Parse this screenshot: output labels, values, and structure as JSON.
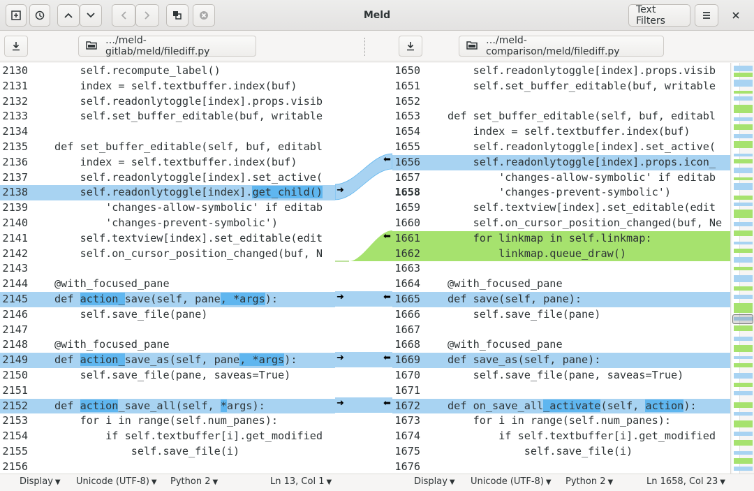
{
  "window": {
    "title": "Meld",
    "text_filters_label": "Text Filters"
  },
  "toolbar": {
    "icons": [
      "new-comparison-icon",
      "recent-icon",
      "prev-change-icon",
      "next-change-icon",
      "back-icon",
      "forward-icon",
      "copy-icon",
      "stop-icon",
      "menu-icon",
      "close-icon"
    ]
  },
  "files": {
    "left_path": "…/meld-gitlab/meld/filediff.py",
    "right_path": "…/meld-comparison/meld/filediff.py"
  },
  "left_lines": [
    {
      "n": "2130",
      "t": "    self.recompute_label()",
      "s": ""
    },
    {
      "n": "2131",
      "t": "    index = self.textbuffer.index(buf)",
      "s": ""
    },
    {
      "n": "2132",
      "t": "    self.readonlytoggle[index].props.visib",
      "s": ""
    },
    {
      "n": "2133",
      "t": "    self.set_buffer_editable(buf, writable",
      "s": ""
    },
    {
      "n": "2134",
      "t": "",
      "s": ""
    },
    {
      "n": "2135",
      "t": "def set_buffer_editable(self, buf, editabl",
      "s": ""
    },
    {
      "n": "2136",
      "t": "    index = self.textbuffer.index(buf)",
      "s": ""
    },
    {
      "n": "2137",
      "t": "    self.readonlytoggle[index].set_active(",
      "s": ""
    },
    {
      "n": "2138",
      "t": "    self.readonlytoggle[index].",
      "h": "get_child()",
      "s": "chg"
    },
    {
      "n": "2139",
      "t": "        'changes-allow-symbolic' if editab",
      "s": ""
    },
    {
      "n": "2140",
      "t": "        'changes-prevent-symbolic')",
      "s": ""
    },
    {
      "n": "2141",
      "t": "    self.textview[index].set_editable(edit",
      "s": ""
    },
    {
      "n": "2142",
      "t": "    self.on_cursor_position_changed(buf, N",
      "s": ""
    },
    {
      "n": "2143",
      "t": "",
      "s": ""
    },
    {
      "n": "2144",
      "t": "@with_focused_pane",
      "s": ""
    },
    {
      "n": "2145",
      "segs": [
        [
          "def ",
          ""
        ],
        [
          "action_",
          "hl"
        ],
        [
          "save(self, pane",
          ""
        ],
        [
          ", *args",
          "hl"
        ],
        [
          "):",
          ""
        ]
      ],
      "s": "chg"
    },
    {
      "n": "2146",
      "t": "    self.save_file(pane)",
      "s": ""
    },
    {
      "n": "2147",
      "t": "",
      "s": ""
    },
    {
      "n": "2148",
      "t": "@with_focused_pane",
      "s": ""
    },
    {
      "n": "2149",
      "segs": [
        [
          "def ",
          ""
        ],
        [
          "action_",
          "hl"
        ],
        [
          "save_as(self, pane",
          ""
        ],
        [
          ", *args",
          "hl"
        ],
        [
          "):",
          ""
        ]
      ],
      "s": "chg"
    },
    {
      "n": "2150",
      "t": "    self.save_file(pane, saveas=True)",
      "s": ""
    },
    {
      "n": "2151",
      "t": "",
      "s": ""
    },
    {
      "n": "2152",
      "segs": [
        [
          "def ",
          ""
        ],
        [
          "action",
          "hl"
        ],
        [
          "_save_all(self, ",
          ""
        ],
        [
          "*",
          "hl"
        ],
        [
          "args):",
          ""
        ]
      ],
      "s": "chg"
    },
    {
      "n": "2153",
      "t": "    for i in range(self.num_panes):",
      "s": ""
    },
    {
      "n": "2154",
      "t": "        if self.textbuffer[i].get_modified",
      "s": ""
    },
    {
      "n": "2155",
      "t": "            self.save_file(i)",
      "s": ""
    },
    {
      "n": "2156",
      "t": "",
      "s": ""
    }
  ],
  "right_lines": [
    {
      "n": "1650",
      "t": "    self.readonlytoggle[index].props.visib",
      "s": ""
    },
    {
      "n": "1651",
      "t": "    self.set_buffer_editable(buf, writable",
      "s": ""
    },
    {
      "n": "1652",
      "t": "",
      "s": ""
    },
    {
      "n": "1653",
      "t": "def set_buffer_editable(self, buf, editabl",
      "s": ""
    },
    {
      "n": "1654",
      "t": "    index = self.textbuffer.index(buf)",
      "s": ""
    },
    {
      "n": "1655",
      "t": "    self.readonlytoggle[index].set_active(",
      "s": ""
    },
    {
      "n": "1656",
      "t": "    self.readonlytoggle[index].props.icon_",
      "s": "chg"
    },
    {
      "n": "1657",
      "t": "        'changes-allow-symbolic' if editab",
      "s": ""
    },
    {
      "n": "1658",
      "t": "        'changes-prevent-symbolic')",
      "s": "",
      "bold": true
    },
    {
      "n": "1659",
      "t": "    self.textview[index].set_editable(edit",
      "s": ""
    },
    {
      "n": "1660",
      "t": "    self.on_cursor_position_changed(buf, Ne",
      "s": ""
    },
    {
      "n": "1661",
      "t": "    for linkmap in self.linkmap:",
      "s": "ins"
    },
    {
      "n": "1662",
      "t": "        linkmap.queue_draw()",
      "s": "ins"
    },
    {
      "n": "1663",
      "t": "",
      "s": ""
    },
    {
      "n": "1664",
      "t": "@with_focused_pane",
      "s": ""
    },
    {
      "n": "1665",
      "t": "def save(self, pane):",
      "s": "chg"
    },
    {
      "n": "1666",
      "t": "    self.save_file(pane)",
      "s": ""
    },
    {
      "n": "1667",
      "t": "",
      "s": ""
    },
    {
      "n": "1668",
      "t": "@with_focused_pane",
      "s": ""
    },
    {
      "n": "1669",
      "t": "def save_as(self, pane):",
      "s": "chg"
    },
    {
      "n": "1670",
      "t": "    self.save_file(pane, saveas=True)",
      "s": ""
    },
    {
      "n": "1671",
      "t": "",
      "s": ""
    },
    {
      "n": "1672",
      "segs": [
        [
          "def on_save_all",
          ""
        ],
        [
          "_activate",
          "hl"
        ],
        [
          "(self, ",
          ""
        ],
        [
          "action",
          "hl"
        ],
        [
          "):",
          ""
        ]
      ],
      "s": "chg"
    },
    {
      "n": "1673",
      "t": "    for i in range(self.num_panes):",
      "s": ""
    },
    {
      "n": "1674",
      "t": "        if self.textbuffer[i].get_modified",
      "s": ""
    },
    {
      "n": "1675",
      "t": "            self.save_file(i)",
      "s": ""
    },
    {
      "n": "1676",
      "t": "",
      "s": ""
    }
  ],
  "status_left": {
    "display": "Display",
    "encoding": "Unicode (UTF-8)",
    "language": "Python 2",
    "position": "Ln 13, Col 1"
  },
  "status_right": {
    "display": "Display",
    "encoding": "Unicode (UTF-8)",
    "language": "Python 2",
    "position": "Ln 1658, Col 23"
  },
  "colors": {
    "changed": "#a8d3f2",
    "inserted": "#a6e26e",
    "inline_highlight": "#5fb6ef"
  }
}
